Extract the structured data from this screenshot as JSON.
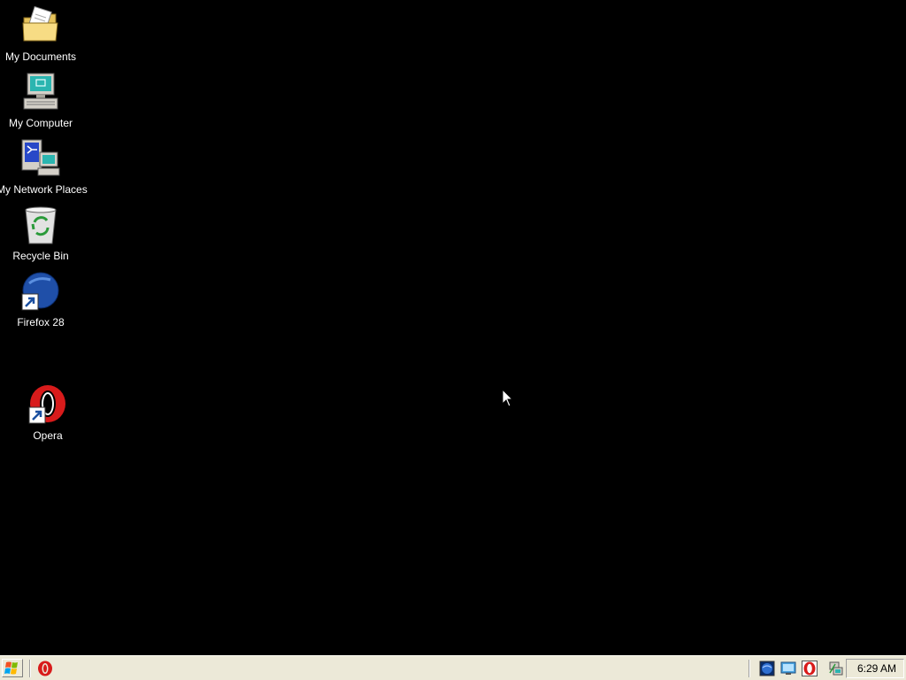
{
  "desktop": {
    "background_color": "#000000",
    "icons": [
      {
        "label": "My Documents",
        "icon": "folder-documents-icon"
      },
      {
        "label": "My Computer",
        "icon": "computer-icon"
      },
      {
        "label": "My Network Places",
        "icon": "network-places-icon"
      },
      {
        "label": "Recycle Bin",
        "icon": "recycle-bin-icon"
      },
      {
        "label": "Firefox 28",
        "icon": "firefox-shortcut-icon"
      },
      {
        "label": "Opera",
        "icon": "opera-shortcut-icon"
      }
    ]
  },
  "taskbar": {
    "background_color": "#ece9d8",
    "start_icon": "windows-flag-icon",
    "quick_launch": [
      {
        "icon": "opera-icon"
      }
    ],
    "tray": {
      "icons": [
        "globe-icon",
        "monitor-icon",
        "opera-icon",
        "network-icon"
      ],
      "clock": "6:29 AM"
    }
  }
}
